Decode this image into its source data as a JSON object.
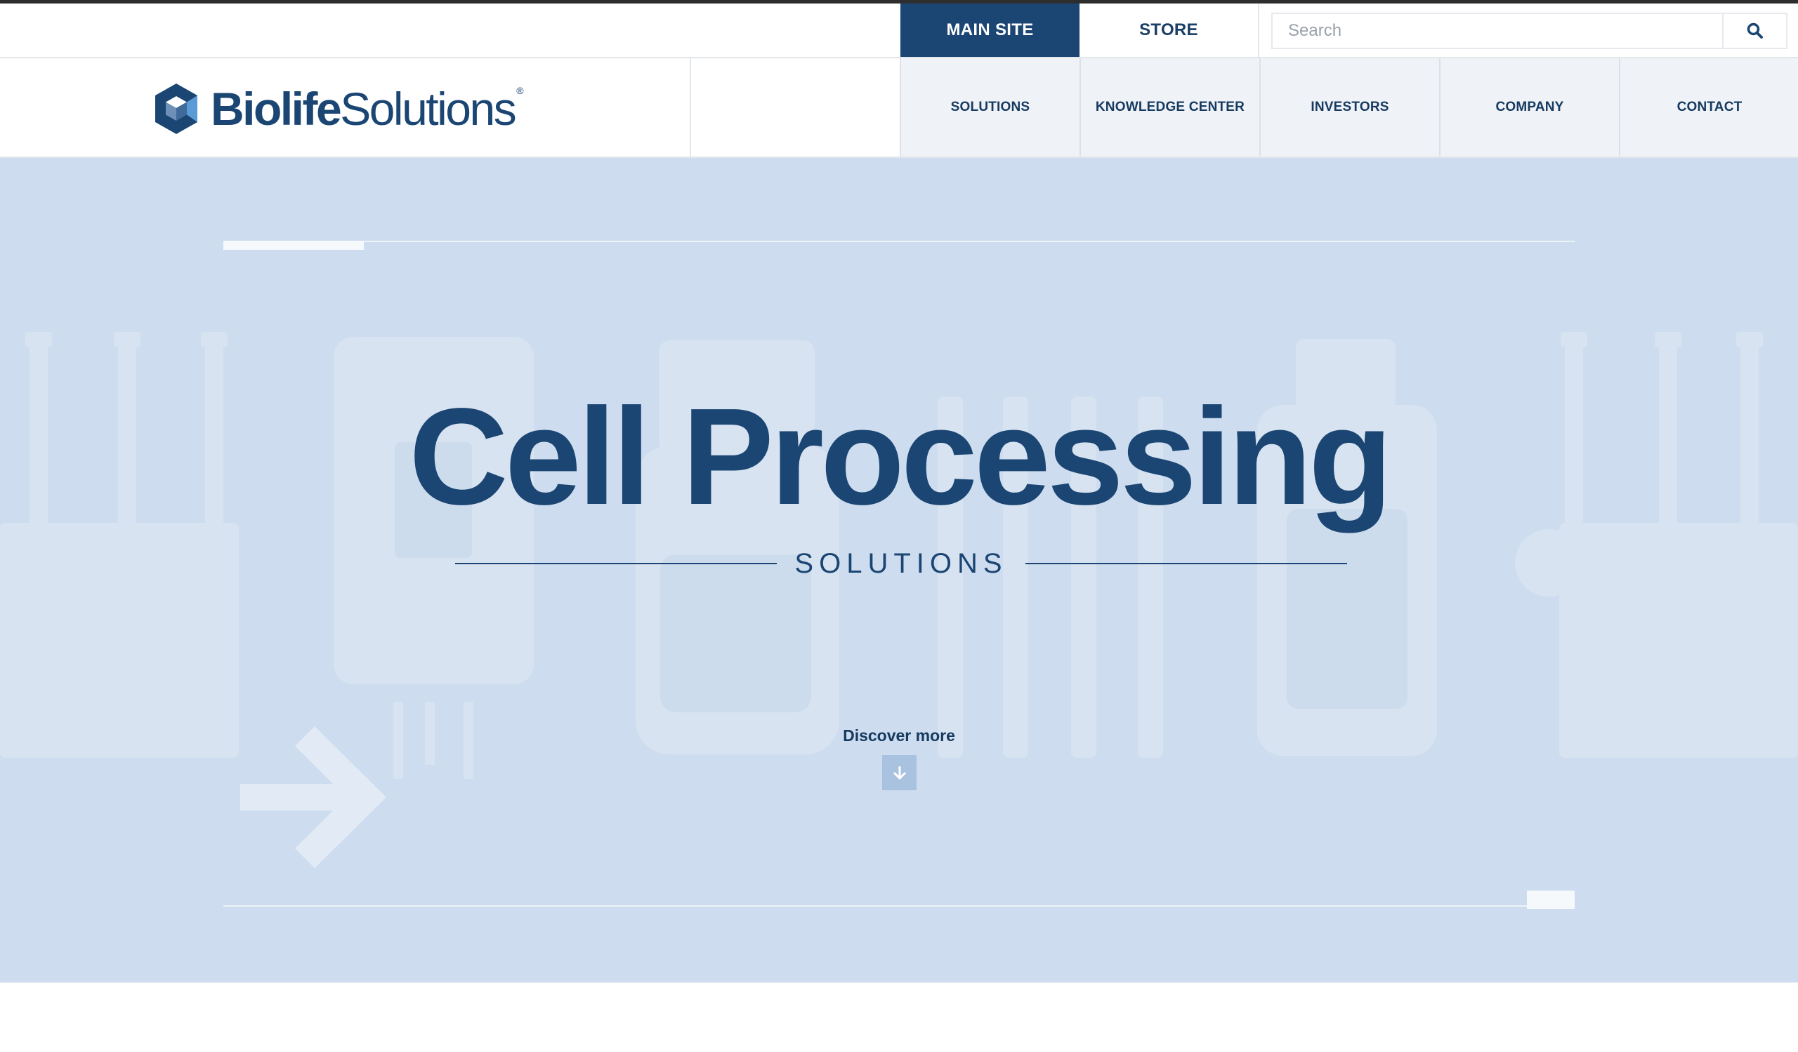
{
  "utility": {
    "main_site_label": "MAIN SITE",
    "store_label": "STORE",
    "search_placeholder": "Search",
    "search_icon": "search-icon"
  },
  "header": {
    "logo": {
      "bold": "Biolife",
      "light": "Solutions",
      "reg": "®",
      "icon": "hexagon-cube-logo-icon"
    },
    "nav": [
      "SOLUTIONS",
      "KNOWLEDGE CENTER",
      "INVESTORS",
      "COMPANY",
      "CONTACT"
    ]
  },
  "hero": {
    "title": "Cell Processing",
    "subtitle": "SOLUTIONS",
    "discover_label": "Discover more",
    "discover_icon": "arrow-down-icon",
    "decor_icon": "arrow-right-icon"
  },
  "colors": {
    "brand_navy": "#1b4673",
    "hero_bg": "#cddcee",
    "nav_bg": "#eff2f7"
  }
}
